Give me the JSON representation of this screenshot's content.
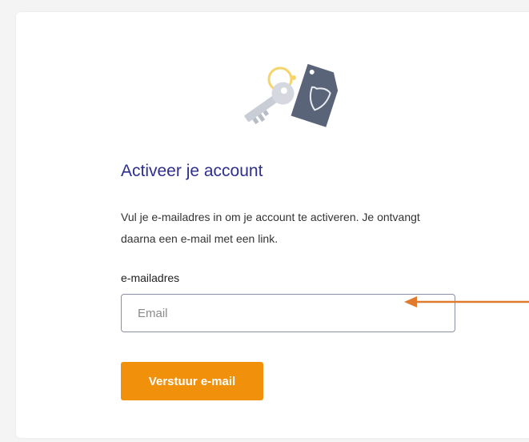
{
  "form": {
    "title": "Activeer je account",
    "description": "Vul je e-mailadres in om je account te activeren. Je ontvangt daarna een e-mail met een link.",
    "email_label": "e-mailadres",
    "email_placeholder": "Email",
    "email_value": "",
    "submit_label": "Verstuur e-mail"
  },
  "colors": {
    "title": "#2e2f8f",
    "button": "#f0900b",
    "arrow": "#e07b2e",
    "tag": "#5a6478",
    "key": "#c9ced6",
    "ring": "#f5d56a"
  },
  "icons": {
    "illustration": "key-with-tag-icon",
    "annotation": "arrow-left-icon"
  }
}
